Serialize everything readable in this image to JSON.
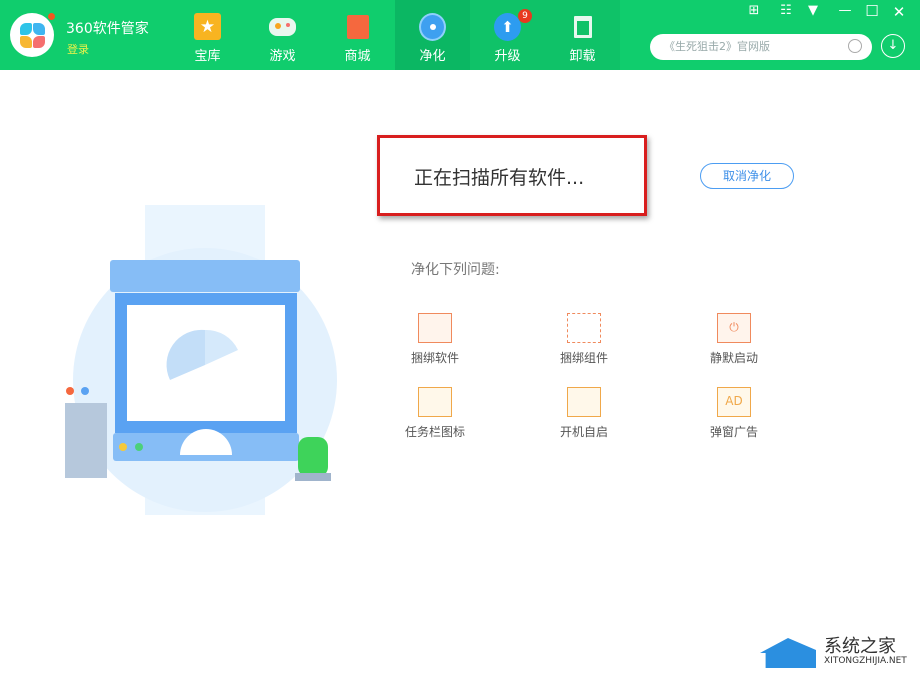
{
  "app": {
    "name": "360软件管家",
    "login": "登录"
  },
  "tabs": [
    {
      "label": "宝库",
      "icon": "star-icon"
    },
    {
      "label": "游戏",
      "icon": "gamepad-icon"
    },
    {
      "label": "商城",
      "icon": "shopping-bag-icon"
    },
    {
      "label": "净化",
      "icon": "fan-icon"
    },
    {
      "label": "升级",
      "icon": "upgrade-arrow-icon",
      "badge": "9"
    },
    {
      "label": "卸载",
      "icon": "trash-icon"
    }
  ],
  "search": {
    "placeholder": "《生死狙击2》官网版"
  },
  "main": {
    "scan_status": "正在扫描所有软件...",
    "cancel_label": "取消净化",
    "issues_heading": "净化下列问题:",
    "issues": [
      {
        "label": "捆绑软件",
        "icon": "bundled-software-icon"
      },
      {
        "label": "捆绑组件",
        "icon": "bundled-component-icon"
      },
      {
        "label": "静默启动",
        "icon": "silent-start-icon"
      },
      {
        "label": "任务栏图标",
        "icon": "taskbar-icon"
      },
      {
        "label": "开机自启",
        "icon": "autostart-icon"
      },
      {
        "label": "弹窗广告",
        "icon": "popup-ad-icon",
        "glyph": "AD"
      }
    ]
  },
  "watermark": {
    "title": "系统之家",
    "subtitle": "XITONGZHIJIA.NET"
  },
  "colors": {
    "brand": "#10cd6d",
    "accent": "#3d8fe8",
    "highlight": "#d81e1e"
  }
}
